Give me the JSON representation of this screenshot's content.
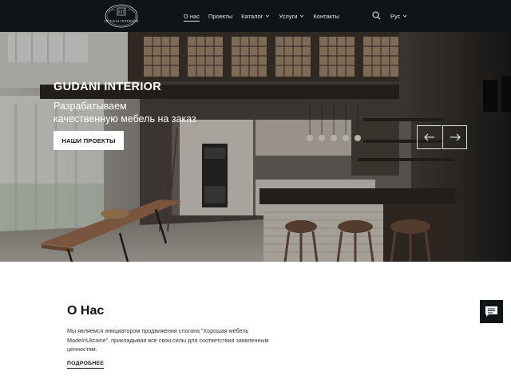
{
  "header": {
    "logo_text": "GUDANI INTERIOR",
    "nav": [
      {
        "label": "О нас",
        "active": true,
        "dropdown": false
      },
      {
        "label": "Проекты",
        "active": false,
        "dropdown": false
      },
      {
        "label": "Каталог",
        "active": false,
        "dropdown": true
      },
      {
        "label": "Услуги",
        "active": false,
        "dropdown": true
      },
      {
        "label": "Контакты",
        "active": false,
        "dropdown": false
      }
    ],
    "search_icon": "search-icon",
    "language": "Рус"
  },
  "hero": {
    "title": "GUDANI INTERIOR",
    "subtitle_line1": "Разрабатываем",
    "subtitle_line2": "качественную мебель на заказ",
    "button_label": "НАШИ ПРОЕКТЫ",
    "prev_icon": "arrow-left-icon",
    "next_icon": "arrow-right-icon"
  },
  "about": {
    "title": "О Нас",
    "text": "Мы являемся инициатором продвижения слогана “Хорошая мебель MadeInUkraine”, прикладывая все свои силы для соответствия заявленным ценностям.",
    "link_label": "ПОДРОБНЕЕ"
  },
  "chat": {
    "icon": "chat-icon"
  },
  "colors": {
    "header_bg": "#0f1416",
    "text_dark": "#111111",
    "white": "#ffffff"
  }
}
